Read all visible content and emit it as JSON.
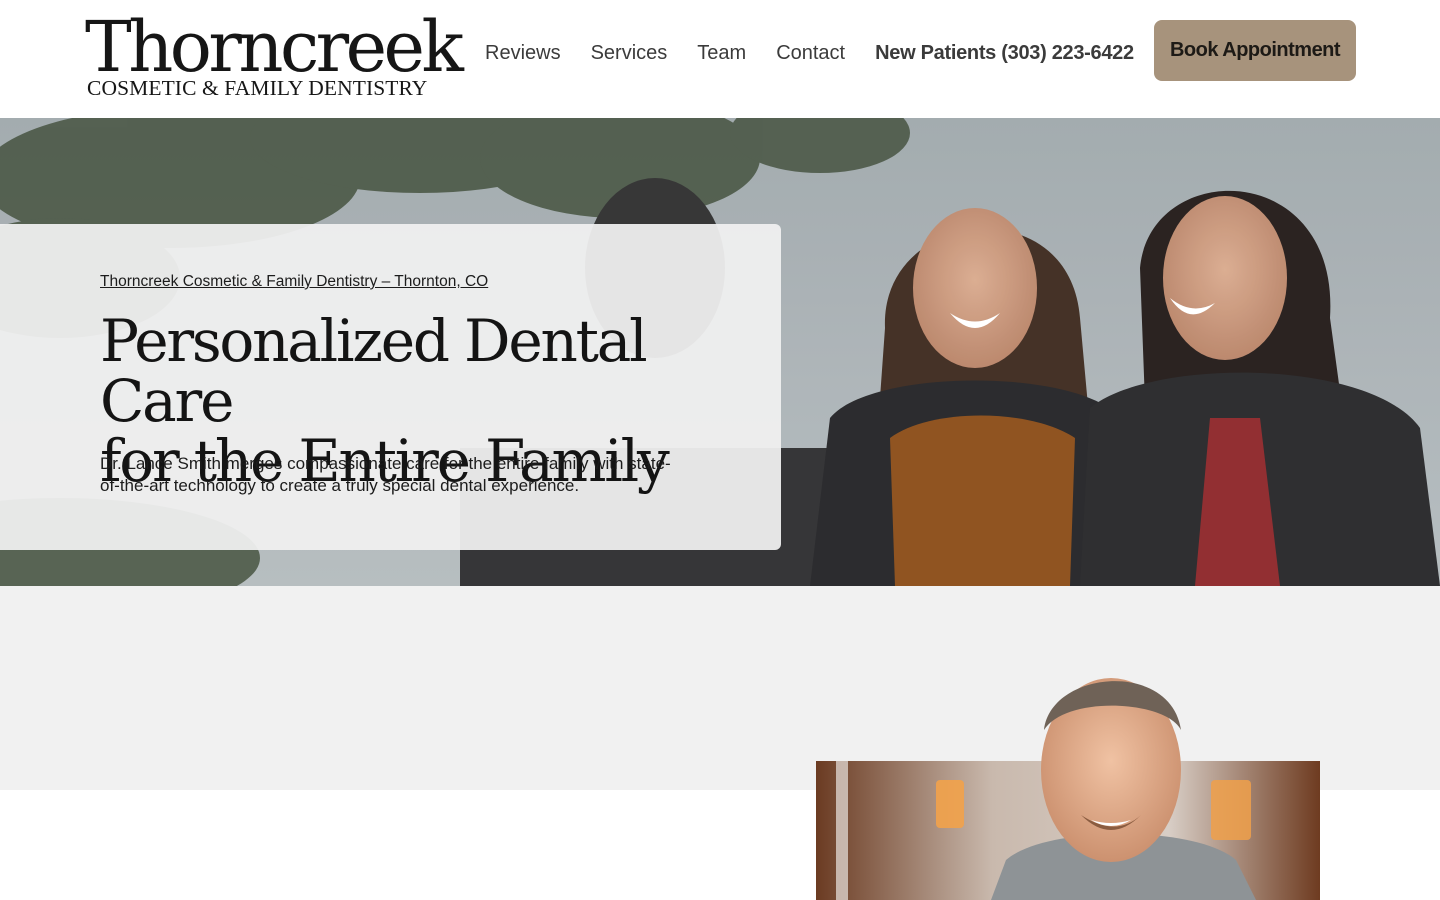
{
  "header": {
    "logo": {
      "name": "Thorncreek",
      "tagline": "COSMETIC & FAMILY DENTISTRY"
    },
    "nav": [
      {
        "label": "Reviews"
      },
      {
        "label": "Services"
      },
      {
        "label": "Team"
      },
      {
        "label": "Contact"
      }
    ],
    "phone_label": "New Patients (303) 223-6422",
    "cta_label": "Book Appointment"
  },
  "hero": {
    "kicker": "Thorncreek Cosmetic & Family Dentistry – Thornton, CO",
    "title_line1": "Personalized Dental Care",
    "title_line2": "for the Entire Family",
    "description": "Dr. Lance Smith merges compassionate care for the entire family with state-of-the-art technology to create a truly special dental experience."
  },
  "colors": {
    "accent": "#a7937c",
    "band_background": "#f1f1f1",
    "text": "#1c1c1c"
  }
}
